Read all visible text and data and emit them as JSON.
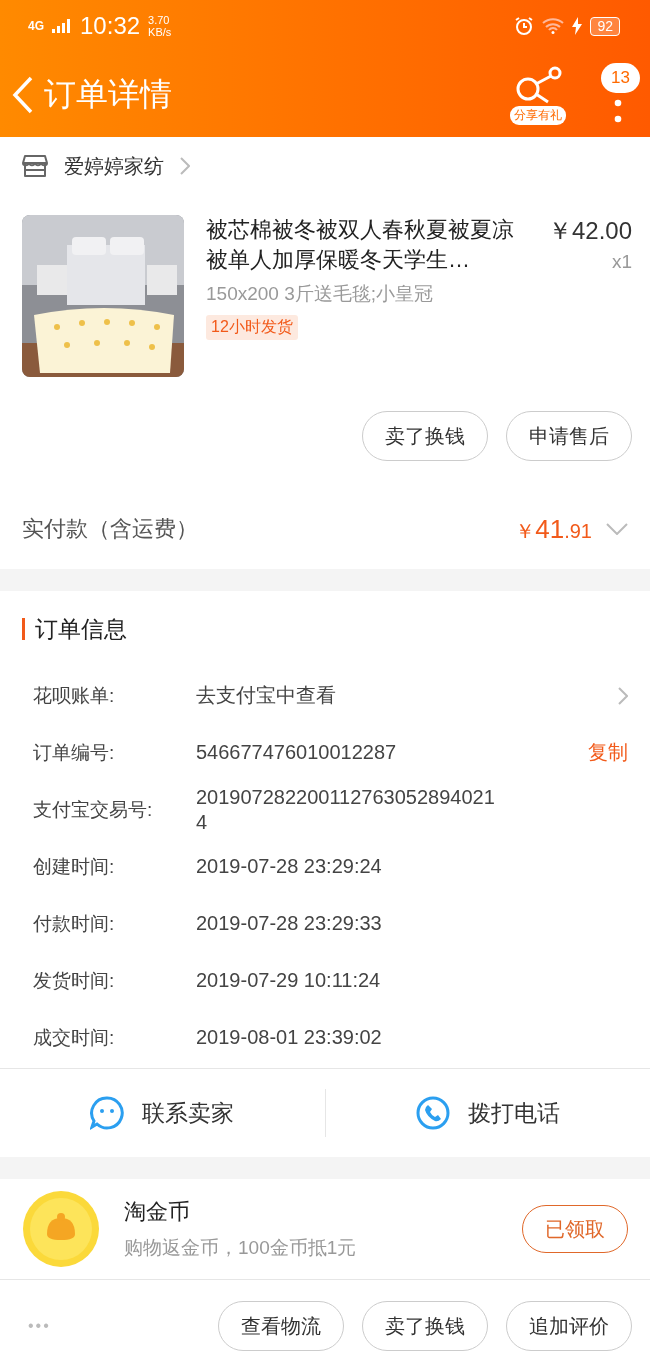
{
  "status_bar": {
    "network": "4G",
    "time": "10:32",
    "speed_value": "3.70",
    "speed_unit": "KB/s",
    "battery": "92"
  },
  "header": {
    "title": "订单详情",
    "share_label": "分享有礼",
    "badge": "13"
  },
  "shop": {
    "name": "爱婷婷家纺"
  },
  "product": {
    "title": "被芯棉被冬被双人春秋夏被夏凉被单人加厚保暖冬天学生…",
    "price": "￥42.00",
    "quantity": "x1",
    "spec": "150x200 3斤送毛毯;小皇冠",
    "tag": "12小时发货",
    "buttons": [
      "卖了换钱",
      "申请售后"
    ]
  },
  "payment": {
    "label": "实付款（含运费）",
    "currency": "￥",
    "amount_int": "41",
    "amount_dec": ".91",
    "expanded": false
  },
  "order_info": {
    "title": "订单信息",
    "rows": [
      {
        "label": "花呗账单:",
        "value": "去支付宝中查看",
        "kind": "link"
      },
      {
        "label": "订单编号:",
        "value": "546677476010012287",
        "kind": "copy",
        "action": "复制"
      },
      {
        "label": "支付宝交易号:",
        "value": "2019072822001127630528940214",
        "kind": "plain"
      },
      {
        "label": "创建时间:",
        "value": "2019-07-28 23:29:24",
        "kind": "plain"
      },
      {
        "label": "付款时间:",
        "value": "2019-07-28 23:29:33",
        "kind": "plain"
      },
      {
        "label": "发货时间:",
        "value": "2019-07-29 10:11:24",
        "kind": "plain"
      },
      {
        "label": "成交时间:",
        "value": "2019-08-01 23:39:02",
        "kind": "plain"
      }
    ]
  },
  "contact": [
    {
      "label": "联系卖家",
      "kind": "chat"
    },
    {
      "label": "拨打电话",
      "kind": "phone"
    }
  ],
  "coins": {
    "title": "淘金币",
    "subtitle": "购物返金币，100金币抵1元",
    "button": "已领取"
  },
  "bottom_bar": {
    "more": "•••",
    "buttons": [
      "查看物流",
      "卖了换钱",
      "追加评价"
    ]
  }
}
